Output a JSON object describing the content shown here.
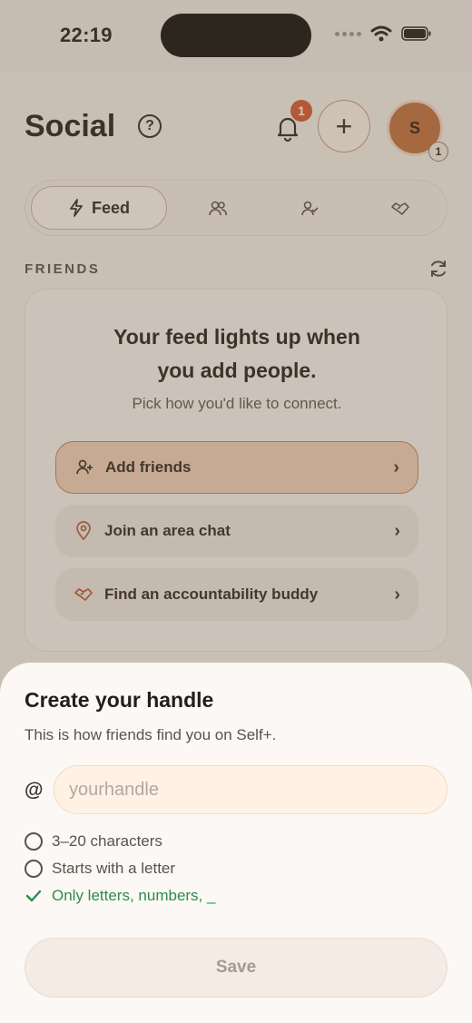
{
  "status_bar": {
    "time": "22:19"
  },
  "header": {
    "title": "Social",
    "help_icon_text": "?",
    "notification_count": "1",
    "add_label": "+",
    "avatar_initial": "S",
    "avatar_badge": "1"
  },
  "tabs": [
    {
      "label": "Feed",
      "icon": "bolt-icon",
      "active": true
    },
    {
      "label": "",
      "icon": "people-icon"
    },
    {
      "label": "",
      "icon": "person-check-icon"
    },
    {
      "label": "",
      "icon": "handshake-icon"
    }
  ],
  "friends": {
    "section_label": "FRIENDS",
    "card_title_line1": "Your feed lights up when",
    "card_title_line2": "you add people.",
    "card_subtitle": "Pick how you'd like to connect.",
    "options": [
      {
        "label": "Add friends",
        "icon": "person-plus-icon"
      },
      {
        "label": "Join an area chat",
        "icon": "location-pin-icon"
      },
      {
        "label": "Find an accountability buddy",
        "icon": "handshake-icon"
      }
    ]
  },
  "sheet": {
    "title": "Create your handle",
    "subtitle": "This is how friends find you on Self+.",
    "at_symbol": "@",
    "input_placeholder": "yourhandle",
    "input_value": "",
    "rules": [
      {
        "label": "3–20 characters",
        "met": false
      },
      {
        "label": "Starts with a letter",
        "met": false
      },
      {
        "label": "Only letters, numbers, _",
        "met": true
      }
    ],
    "save_label": "Save"
  },
  "colors": {
    "accent": "#c2703a",
    "badge": "#d9572c",
    "success": "#2f8a4f"
  }
}
